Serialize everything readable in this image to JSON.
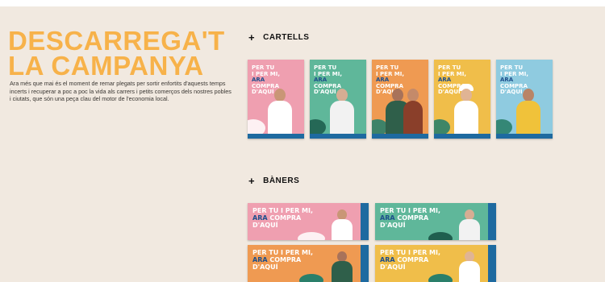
{
  "hero": {
    "title_line1": "DESCARREGA'T",
    "title_line2": "LA CAMPANYA",
    "description": "Ara més que mai és el moment de remar plegats per sortir enfortits d'aquests temps incerts i recuperar a poc a poc la vida als carrers i petits comerços dels nostres pobles i ciutats, que són una peça clau del motor de l'economia local."
  },
  "sections": {
    "cartells": {
      "plus": "+",
      "label": "CARTELLS"
    },
    "baners": {
      "plus": "+",
      "label": "BÀNERS"
    }
  },
  "campaign_text": {
    "line1": "PER TU",
    "line2": "I PER MI,",
    "ara": "ARA",
    "compra": "COMPRA",
    "daqui": "D'AQUÍ",
    "banner_line1": "PER TU I PER MI,"
  },
  "posters": [
    {
      "bg": "#ef9fb0",
      "shirt": "#ffffff"
    },
    {
      "bg": "#5fb79a",
      "shirt": "#f2f2f2"
    },
    {
      "bg": "#ef9a52",
      "shirt": "#2f5f4a"
    },
    {
      "bg": "#f0be4a",
      "shirt": "#ffffff",
      "hat": true
    },
    {
      "bg": "#8fcbe0",
      "shirt": "#f0c23a"
    }
  ],
  "banners": [
    {
      "bg": "#ef9fb0"
    },
    {
      "bg": "#5fb79a"
    },
    {
      "bg": "#ef9a52"
    },
    {
      "bg": "#f0be4a"
    }
  ],
  "colors": {
    "accent": "#f7b24a",
    "background": "#f1e9e0"
  }
}
